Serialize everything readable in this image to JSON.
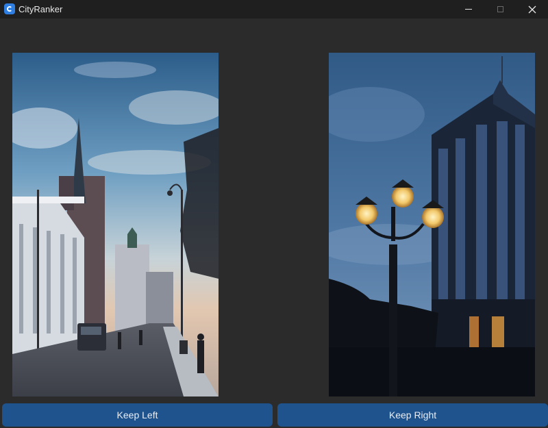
{
  "window": {
    "title": "CityRanker",
    "icons": {
      "app": "app-logo-icon",
      "minimize": "minimize-icon",
      "maximize": "maximize-icon",
      "close": "close-icon"
    },
    "close_glyph": "✕"
  },
  "images": {
    "left": {
      "description_icon": "city-street-photo"
    },
    "right": {
      "description_icon": "street-lamp-tower-photo"
    }
  },
  "actions": {
    "keep_left_label": "Keep Left",
    "keep_right_label": "Keep Right"
  },
  "colors": {
    "background": "#2b2b2b",
    "titlebar": "#1f1f1f",
    "button": "#1f538d",
    "accent_icon": "#2f7fe3"
  }
}
